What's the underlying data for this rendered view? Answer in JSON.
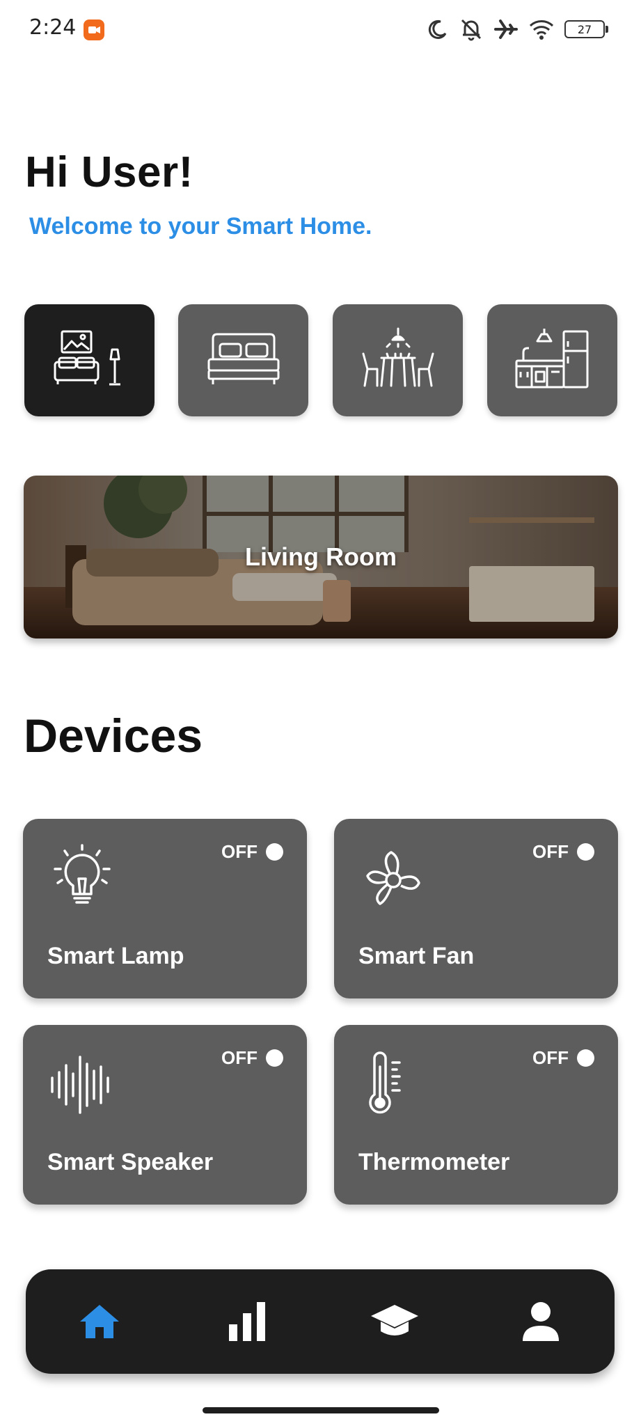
{
  "status_bar": {
    "time": "2:24",
    "battery_level": "27",
    "icons": [
      "screen-record-icon",
      "moon-icon",
      "bell-off-icon",
      "airplane-icon",
      "wifi-icon",
      "battery-icon"
    ]
  },
  "header": {
    "greeting": "Hi User!",
    "welcome": "Welcome to your Smart Home."
  },
  "rooms": [
    {
      "icon": "living-room-icon",
      "selected": true
    },
    {
      "icon": "bed-icon",
      "selected": false
    },
    {
      "icon": "dining-room-icon",
      "selected": false
    },
    {
      "icon": "kitchen-icon",
      "selected": false
    }
  ],
  "banner": {
    "title": "Living Room"
  },
  "devices": {
    "title": "Devices",
    "items": [
      {
        "name": "Smart Lamp",
        "state": "OFF",
        "icon": "lightbulb-icon"
      },
      {
        "name": "Smart Fan",
        "state": "OFF",
        "icon": "fan-icon"
      },
      {
        "name": "Smart Speaker",
        "state": "OFF",
        "icon": "sound-wave-icon"
      },
      {
        "name": "Thermometer",
        "state": "OFF",
        "icon": "thermometer-icon"
      }
    ]
  },
  "bottom_nav": {
    "items": [
      {
        "icon": "home-icon",
        "active": true
      },
      {
        "icon": "bar-chart-icon",
        "active": false
      },
      {
        "icon": "graduation-cap-icon",
        "active": false
      },
      {
        "icon": "person-icon",
        "active": false
      }
    ]
  },
  "colors": {
    "accent": "#2d8ee6",
    "card": "#5d5d5d",
    "dark": "#1e1e1e",
    "record": "#f26b1d"
  }
}
